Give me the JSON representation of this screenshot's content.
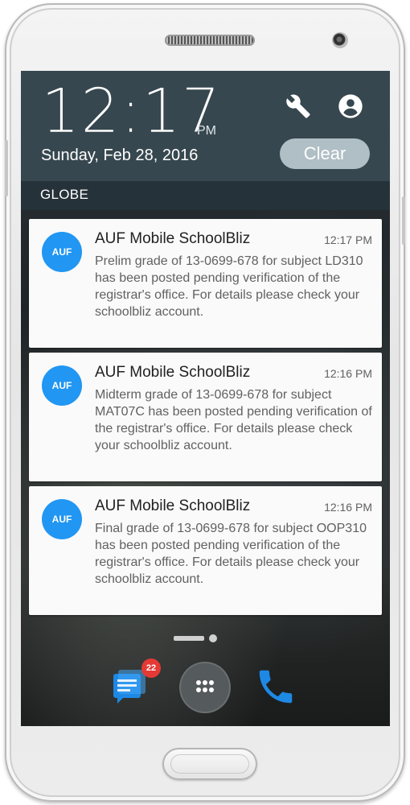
{
  "status": {
    "time": "12:17",
    "ampm": "PM",
    "date": "Sunday, Feb 28, 2016",
    "clear_label": "Clear",
    "carrier": "GLOBE"
  },
  "notifications": [
    {
      "icon_text": "AUF",
      "app": "AUF Mobile SchoolBliz",
      "time": "12:17 PM",
      "body": "Prelim grade of 13-0699-678 for subject LD310 has been posted pending verification of the registrar's office. For details please check your schoolbliz account."
    },
    {
      "icon_text": "AUF",
      "app": "AUF Mobile SchoolBliz",
      "time": "12:16 PM",
      "body": "Midterm grade of 13-0699-678 for subject MAT07C has been posted pending verification of the registrar's office. For details please check your schoolbliz account."
    },
    {
      "icon_text": "AUF",
      "app": "AUF Mobile SchoolBliz",
      "time": "12:16 PM",
      "body": "Final grade of 13-0699-678 for subject OOP310 has been posted pending verification of the registrar's office. For details please check your schoolbliz account."
    }
  ],
  "dock": {
    "messages_badge": "22"
  },
  "colors": {
    "shade": "#37474f",
    "accent": "#2196f3",
    "clear_button": "#b0bec5",
    "badge": "#e53935"
  },
  "icons": [
    "wrench-icon",
    "account-icon",
    "messages-icon",
    "app-drawer-icon",
    "phone-icon"
  ]
}
